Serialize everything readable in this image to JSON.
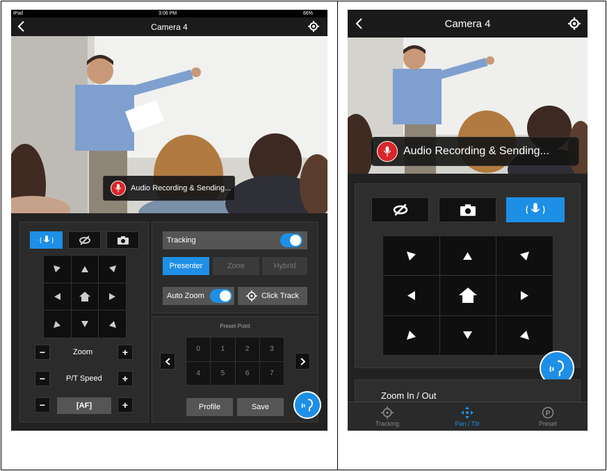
{
  "ipad": {
    "status": {
      "carrier": "iPad",
      "time": "3:06 PM",
      "battery": "66%"
    },
    "nav": {
      "title": "Camera 4",
      "back_icon": "chevron-left-icon",
      "settings_icon": "gear-icon"
    },
    "recording_badge": "Audio Recording & Sending...",
    "mode_buttons": [
      "voice-track-icon",
      "eye-off-icon",
      "camera-icon"
    ],
    "tracking": {
      "label": "Tracking",
      "on": true
    },
    "modes": {
      "presenter": "Presenter",
      "zone": "Zone",
      "hybrid": "Hybrid"
    },
    "auto_zoom": {
      "label": "Auto Zoom",
      "on": true
    },
    "click_track": "Click Track",
    "zoom_label": "Zoom",
    "speed_label": "P/T Speed",
    "af_label": "[AF]",
    "minus": "−",
    "plus": "+",
    "preset_title": "Preset Point",
    "presets": [
      "0",
      "1",
      "2",
      "3",
      "4",
      "5",
      "6",
      "7"
    ],
    "profile": "Profile",
    "save": "Save"
  },
  "phone": {
    "nav": {
      "title": "Camera 4"
    },
    "recording_badge": "Audio Recording & Sending...",
    "zoom_section": "Zoom In / Out",
    "tabs": [
      {
        "label": "Tracking",
        "icon": "target-icon"
      },
      {
        "label": "Pan / Tilt",
        "icon": "move-icon"
      },
      {
        "label": "Preset",
        "icon": "preset-icon"
      }
    ]
  },
  "colors": {
    "accent": "#1e8fe6",
    "record": "#d9262a",
    "panel": "#2b2b2b"
  }
}
